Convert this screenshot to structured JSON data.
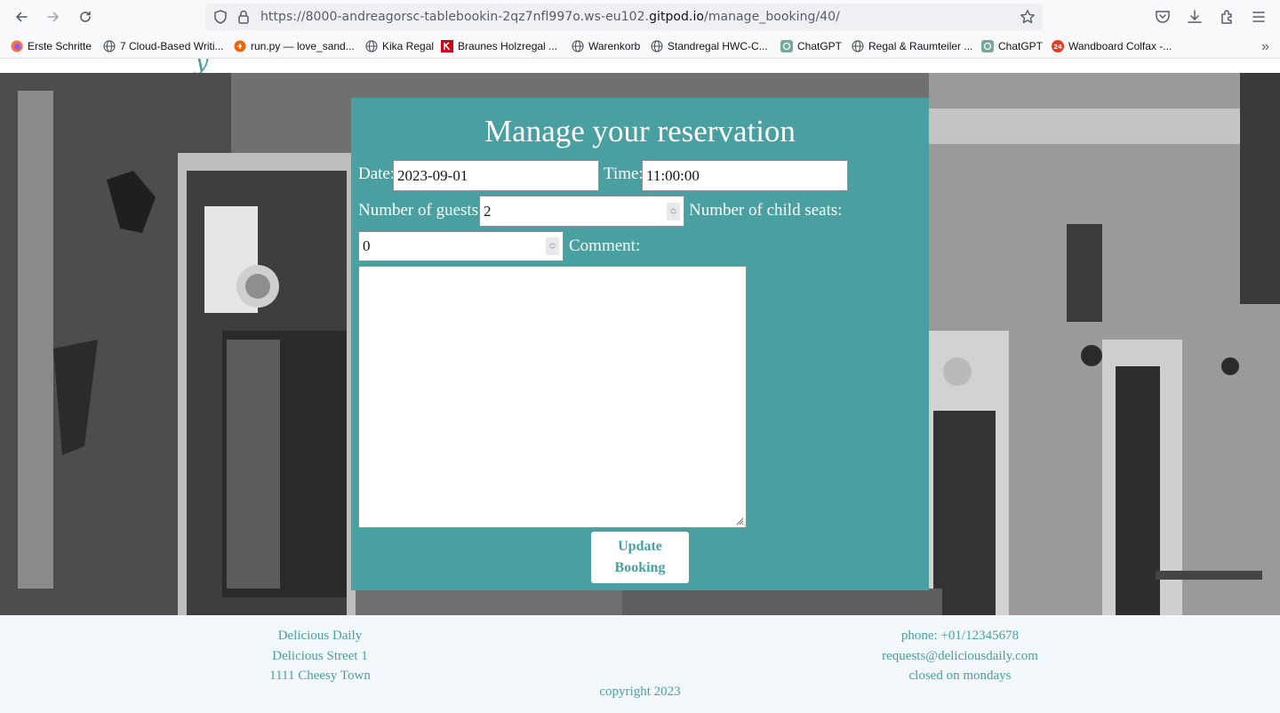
{
  "browser": {
    "url_prefix": "https://8000-andreagorsc-tablebookin-2qz7nfl997o.ws-eu102.",
    "url_host": "gitpod.io",
    "url_path": "/manage_booking/40/"
  },
  "bookmarks": [
    {
      "label": "Erste Schritte",
      "icon": "firefox-icon"
    },
    {
      "label": "7 Cloud-Based Writi...",
      "icon": "globe-icon"
    },
    {
      "label": "run.py — love_sand...",
      "icon": "replit-icon"
    },
    {
      "label": "Kika Regal",
      "icon": "globe-icon"
    },
    {
      "label": "Braunes Holzregal ...",
      "icon": "k-brand-icon"
    },
    {
      "label": "Warenkorb",
      "icon": "globe-icon"
    },
    {
      "label": "Standregal HWC-C...",
      "icon": "globe-icon"
    },
    {
      "label": "ChatGPT",
      "icon": "chatgpt-icon"
    },
    {
      "label": "Regal & Raumteiler ...",
      "icon": "globe-icon"
    },
    {
      "label": "ChatGPT",
      "icon": "chatgpt-icon"
    },
    {
      "label": "Wandboard Colfax -...",
      "icon": "24-brand-icon"
    }
  ],
  "form": {
    "title": "Manage your reservation",
    "date_label": "Date:",
    "date_value": "2023-09-01",
    "time_label": "Time:",
    "time_value": "11:00:00",
    "guests_label": "Number of guests:",
    "guests_value": "2",
    "child_seats_label": "Number of child seats:",
    "child_seats_value": "0",
    "comment_label": "Comment:",
    "comment_value": "",
    "submit_label": "Update Booking"
  },
  "footer": {
    "left": [
      "Delicious Daily",
      "Delicious Street 1",
      "1111 Cheesy Town"
    ],
    "right": [
      "phone: +01/12345678",
      "requests@deliciousdaily.com",
      "closed on mondays"
    ],
    "copyright": "copyright 2023"
  },
  "colors": {
    "teal": "#4a9fa0",
    "footer_bg": "#f2f8fb"
  }
}
